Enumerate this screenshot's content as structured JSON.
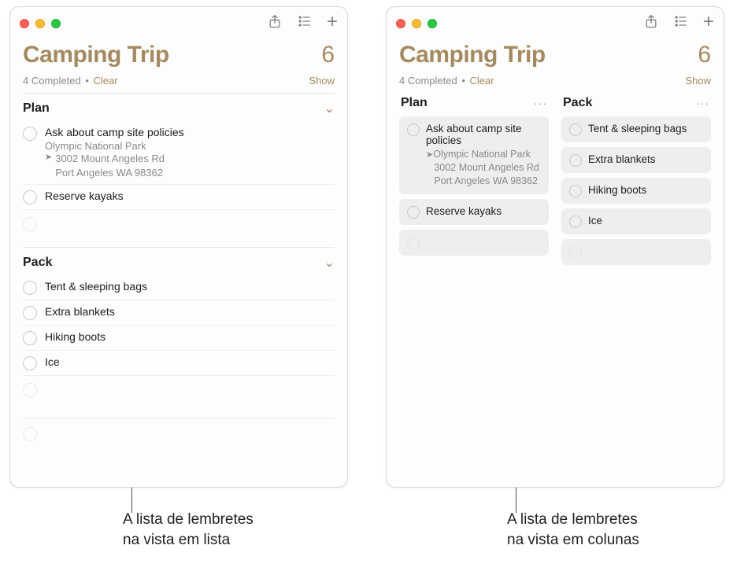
{
  "list": {
    "title": "Camping Trip",
    "count": "6",
    "completed_text": "4 Completed",
    "clear": "Clear",
    "show": "Show"
  },
  "sections": {
    "plan": {
      "title": "Plan",
      "items": [
        {
          "title": "Ask about camp site policies",
          "sub": "Olympic National Park",
          "addr1": "3002 Mount Angeles Rd",
          "addr2": "Port Angeles WA 98362"
        },
        {
          "title": "Reserve kayaks"
        }
      ]
    },
    "pack": {
      "title": "Pack",
      "items": [
        {
          "title": "Tent & sleeping bags"
        },
        {
          "title": "Extra blankets"
        },
        {
          "title": "Hiking boots"
        },
        {
          "title": "Ice"
        }
      ]
    }
  },
  "captions": {
    "left_l1": "A lista de lembretes",
    "left_l2": "na vista em lista",
    "right_l1": "A lista de lembretes",
    "right_l2": "na vista em colunas"
  }
}
